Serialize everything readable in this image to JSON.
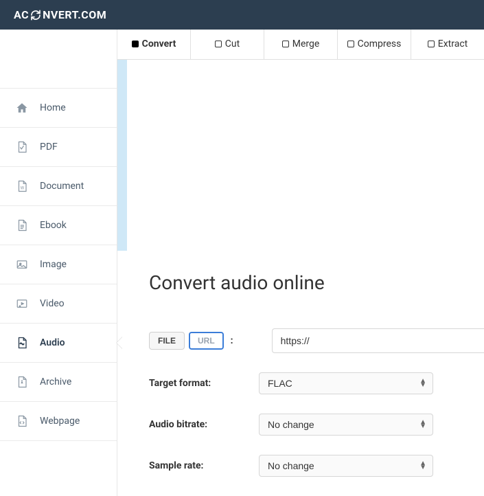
{
  "brand": {
    "part1": "AC",
    "part2": "NVERT.COM"
  },
  "sidebar": {
    "items": [
      {
        "label": "Home"
      },
      {
        "label": "PDF"
      },
      {
        "label": "Document"
      },
      {
        "label": "Ebook"
      },
      {
        "label": "Image"
      },
      {
        "label": "Video"
      },
      {
        "label": "Audio"
      },
      {
        "label": "Archive"
      },
      {
        "label": "Webpage"
      }
    ],
    "activeIndex": 6
  },
  "tabs": [
    {
      "label": "Convert",
      "active": true
    },
    {
      "label": "Cut",
      "active": false
    },
    {
      "label": "Merge",
      "active": false
    },
    {
      "label": "Compress",
      "active": false
    },
    {
      "label": "Extract",
      "active": false
    }
  ],
  "page": {
    "title": "Convert audio online"
  },
  "source": {
    "fileLabel": "FILE",
    "urlLabel": "URL",
    "selected": "url",
    "urlValue": "https://"
  },
  "form": {
    "targetFormat": {
      "label": "Target format:",
      "value": "FLAC"
    },
    "audioBitrate": {
      "label": "Audio bitrate:",
      "value": "No change"
    },
    "sampleRate": {
      "label": "Sample rate:",
      "value": "No change"
    }
  }
}
